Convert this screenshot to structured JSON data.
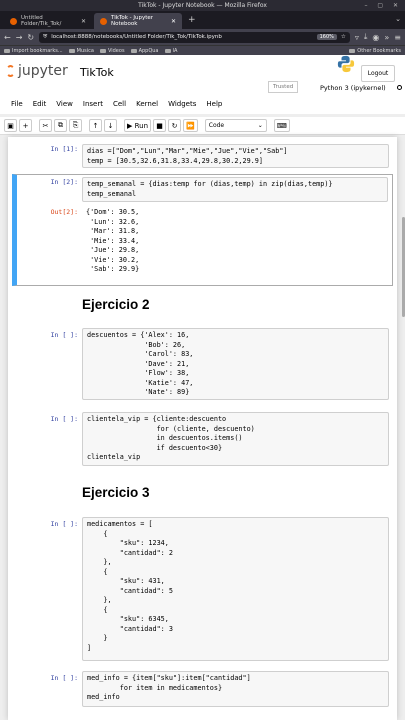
{
  "window": {
    "title": "TikTok - Jupyter Notebook — Mozilla Firefox"
  },
  "tabs": [
    {
      "label": "Untitled Folder/Tik_Tok/",
      "active": false
    },
    {
      "label": "TikTok - Jupyter Notebook",
      "active": true
    }
  ],
  "address": {
    "url": "localhost:8888/notebooks/Untitled Folder/Tik_Tok/TikTok.ipynb",
    "zoom": "160%"
  },
  "bookmarks": {
    "items": [
      "Import bookmarks...",
      "Musica",
      "Videos",
      "AppQua",
      "IA"
    ],
    "other": "Other Bookmarks"
  },
  "jupyter": {
    "logo_text": "jupyter",
    "notebook_name": "TikTok",
    "logout": "Logout",
    "trusted": "Trusted",
    "kernel": "Python 3 (ipykernel)"
  },
  "menu": [
    "File",
    "Edit",
    "View",
    "Insert",
    "Cell",
    "Kernel",
    "Widgets",
    "Help"
  ],
  "toolbar": {
    "run_label": "Run",
    "cell_type": "Code"
  },
  "cells": {
    "c1": {
      "prompt": "In [1]:",
      "code": "dias =[\"Dom\",\"Lun\",\"Mar\",\"Mie\",\"Jue\",\"Vie\",\"Sab\"]\ntemp = [30.5,32.6,31.8,33.4,29.8,30.2,29.9]"
    },
    "c2": {
      "prompt": "In [2]:",
      "code": "temp_semanal = {dias:temp for (dias,temp) in zip(dias,temp)}\ntemp_semanal",
      "out_prompt": "Out[2]:",
      "output": "{'Dom': 30.5,\n 'Lun': 32.6,\n 'Mar': 31.8,\n 'Mie': 33.4,\n 'Jue': 29.8,\n 'Vie': 30.2,\n 'Sab': 29.9}"
    },
    "h1": {
      "text": "Ejercicio 2"
    },
    "c3": {
      "prompt": "In [ ]:",
      "code": "descuentos = {'Alex': 16,\n              'Bob': 26,\n              'Carol': 83,\n              'Dave': 21,\n              'Flow': 38,\n              'Katie': 47,\n              'Nate': 89}"
    },
    "c4": {
      "prompt": "In [ ]:",
      "code": "clientela_vip = {cliente:descuento\n                 for (cliente, descuento)\n                 in descuentos.items()\n                 if descuento<30}\nclientela_vip"
    },
    "h2": {
      "text": "Ejercicio 3"
    },
    "c5": {
      "prompt": "In [ ]:",
      "code": "medicamentos = [\n    {\n        \"sku\": 1234,\n        \"cantidad\": 2\n    },\n    {\n        \"sku\": 431,\n        \"cantidad\": 5\n    },\n    {\n        \"sku\": 6345,\n        \"cantidad\": 3\n    }\n]"
    },
    "c6": {
      "prompt": "In [ ]:",
      "code": "med_info = {item[\"sku\"]:item[\"cantidad\"]\n        for item in medicamentos}\nmed_info"
    }
  }
}
